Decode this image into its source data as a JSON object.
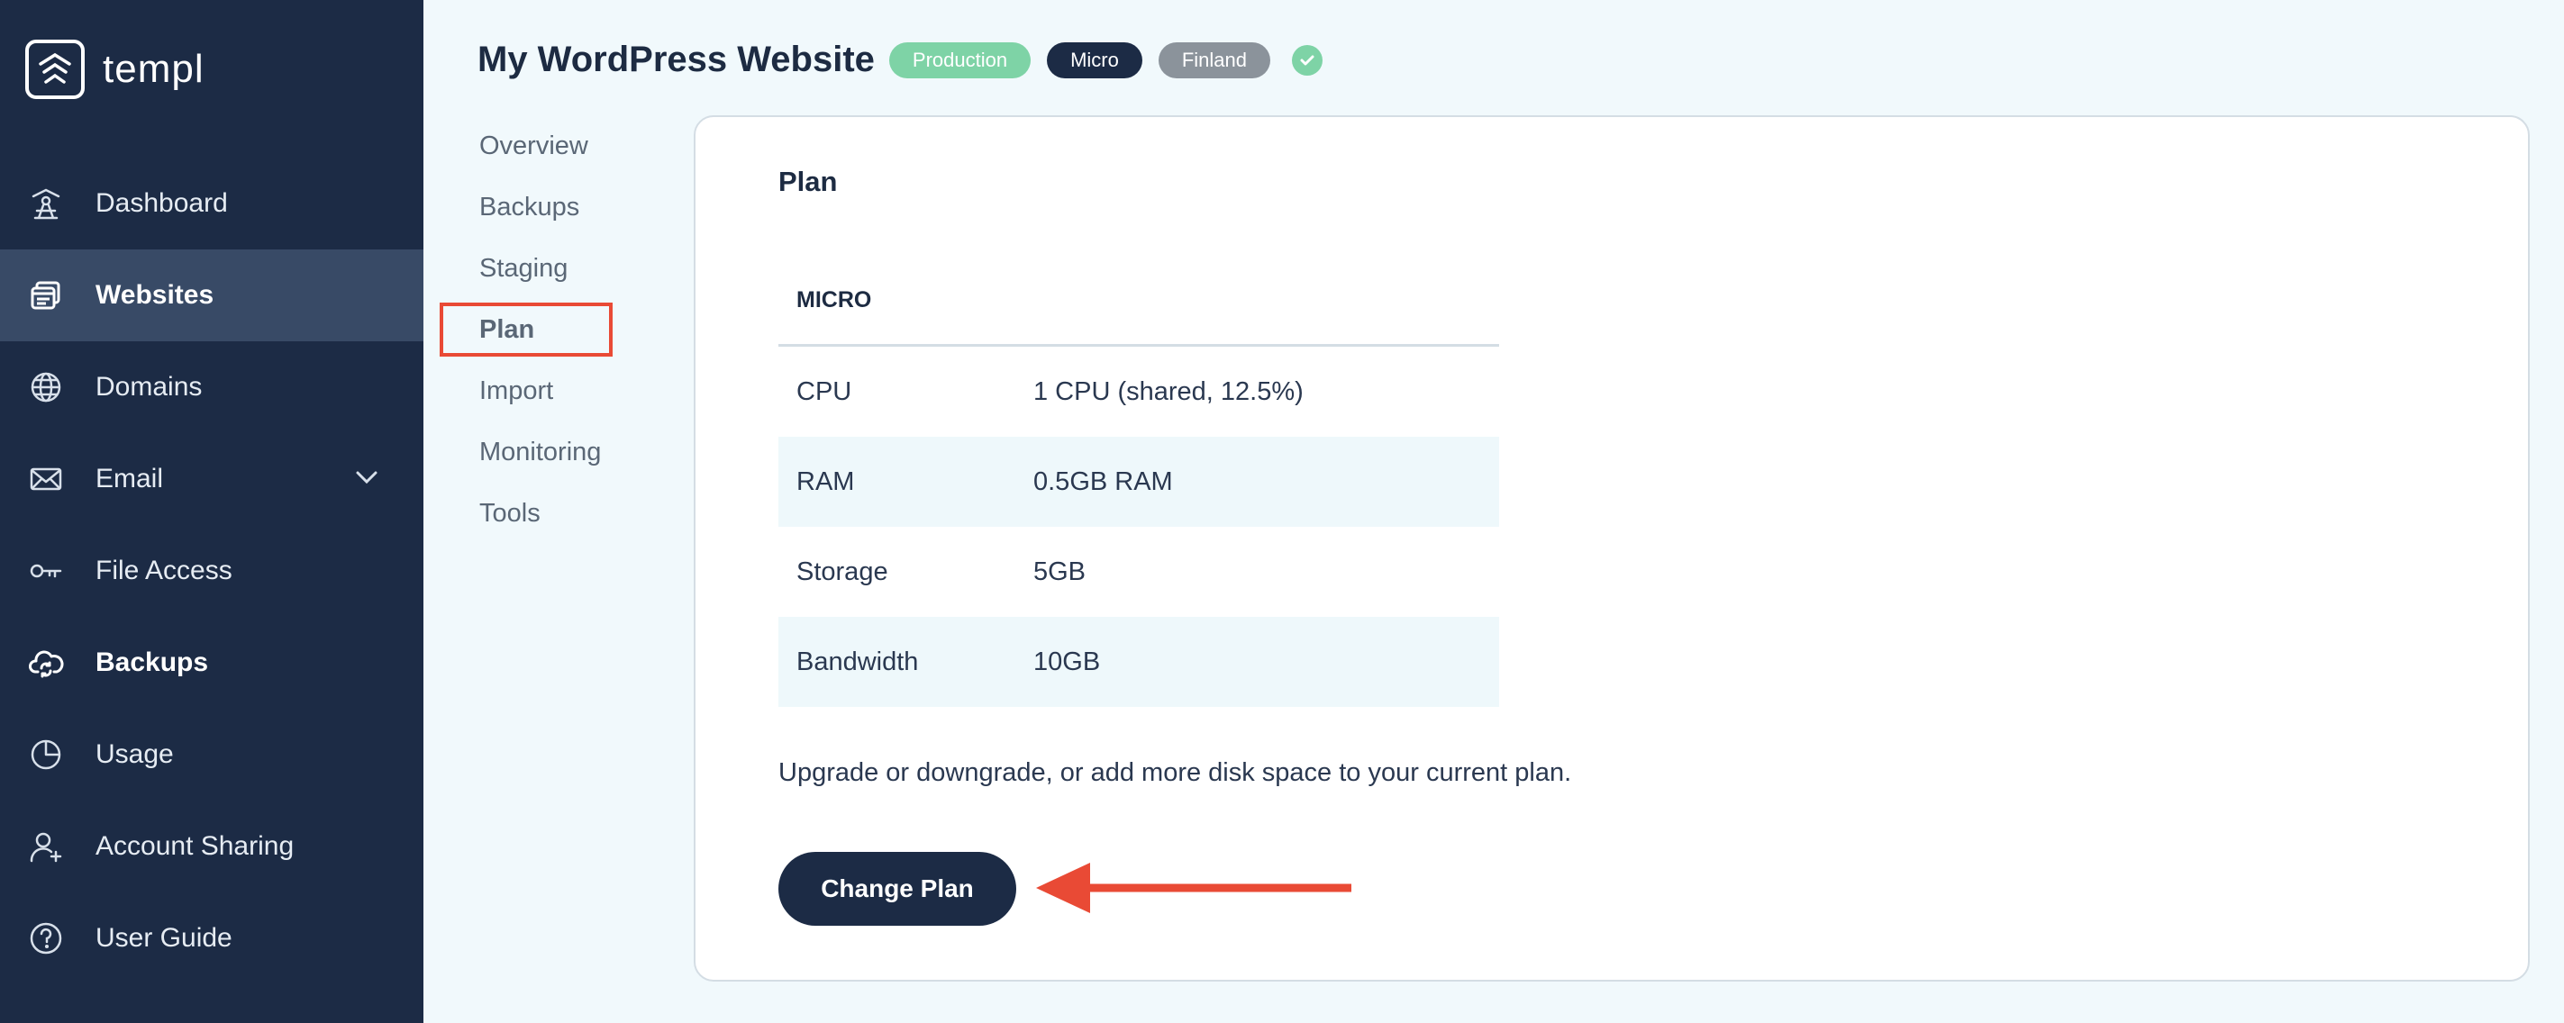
{
  "brand": {
    "name": "templ"
  },
  "sidebar": {
    "items": [
      {
        "label": "Dashboard",
        "icon": "dashboard-icon"
      },
      {
        "label": "Websites",
        "icon": "websites-icon"
      },
      {
        "label": "Domains",
        "icon": "globe-icon"
      },
      {
        "label": "Email",
        "icon": "mail-icon"
      },
      {
        "label": "File Access",
        "icon": "key-icon"
      },
      {
        "label": "Backups",
        "icon": "cloud-sync-icon"
      },
      {
        "label": "Usage",
        "icon": "pie-chart-icon"
      },
      {
        "label": "Account Sharing",
        "icon": "user-add-icon"
      },
      {
        "label": "User Guide",
        "icon": "help-icon"
      }
    ]
  },
  "header": {
    "title": "My WordPress Website",
    "badges": [
      "Production",
      "Micro",
      "Finland"
    ]
  },
  "subnav": {
    "items": [
      "Overview",
      "Backups",
      "Staging",
      "Plan",
      "Import",
      "Monitoring",
      "Tools"
    ],
    "active": "Plan"
  },
  "plan": {
    "heading": "Plan",
    "plan_name": "MICRO",
    "rows": [
      {
        "label": "CPU",
        "value": "1 CPU (shared, 12.5%)"
      },
      {
        "label": "RAM",
        "value": "0.5GB RAM"
      },
      {
        "label": "Storage",
        "value": "5GB"
      },
      {
        "label": "Bandwidth",
        "value": "10GB"
      }
    ],
    "upgrade_text": "Upgrade or downgrade, or add more disk space to your current plan.",
    "change_button": "Change Plan"
  },
  "colors": {
    "sidebar_bg": "#1c2b45",
    "active_nav": "#384a66",
    "accent_red": "#e94a35",
    "badge_green": "#7ed3a6"
  }
}
